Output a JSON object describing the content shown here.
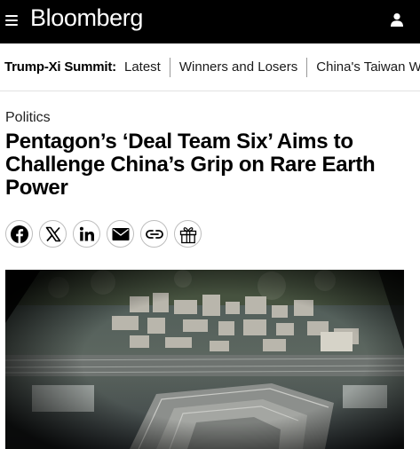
{
  "header": {
    "logo_text": "Bloomberg",
    "menu_icon": "hamburger-menu-icon",
    "account_icon": "user-icon",
    "background": "#000000"
  },
  "subnav": {
    "topic": "Trump-Xi Summit:",
    "links": [
      "Latest",
      "Winners and Losers",
      "China's Taiwan War"
    ]
  },
  "article": {
    "section": "Politics",
    "headline": "Pentagon’s ‘Deal Team Six’ Aims to Challenge China’s Grip on Rare Earth Power"
  },
  "share": {
    "buttons": [
      "facebook-icon",
      "x-icon",
      "linkedin-icon",
      "email-icon",
      "link-icon",
      "gift-icon"
    ]
  },
  "hero_image": {
    "subject": "aerial-photo"
  }
}
